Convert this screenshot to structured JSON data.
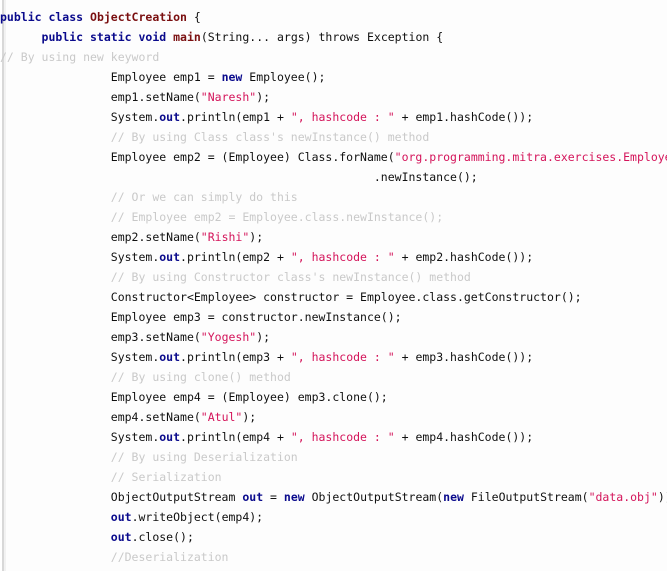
{
  "editor": {
    "language": "java",
    "background_color": "#fdfdfd",
    "colors": {
      "keyword": "#0a0a8c",
      "type_name": "#7a0f10",
      "string": "#d4145a",
      "comment": "#c9c9c9",
      "plain": "#101010"
    }
  },
  "code": {
    "lines": [
      {
        "indent": 0,
        "tokens": [
          {
            "t": "public class ",
            "c": "kw"
          },
          {
            "t": "ObjectCreation",
            "c": "type"
          },
          {
            "t": " {",
            "c": "plain"
          }
        ]
      },
      {
        "indent": 3,
        "tokens": [
          {
            "t": "public static void ",
            "c": "kw"
          },
          {
            "t": "main",
            "c": "type"
          },
          {
            "t": "(String... args) throws Exception {",
            "c": "plain"
          }
        ]
      },
      {
        "indent": -5,
        "tokens": [
          {
            "t": "// By using new keyword",
            "c": "cmt"
          }
        ]
      },
      {
        "indent": 8,
        "tokens": [
          {
            "t": "Employee emp1 = ",
            "c": "plain"
          },
          {
            "t": "new",
            "c": "kw"
          },
          {
            "t": " Employee();",
            "c": "plain"
          }
        ]
      },
      {
        "indent": 8,
        "tokens": [
          {
            "t": "emp1.setName(",
            "c": "plain"
          },
          {
            "t": "\"Naresh\"",
            "c": "str"
          },
          {
            "t": ");",
            "c": "plain"
          }
        ]
      },
      {
        "indent": 8,
        "tokens": [
          {
            "t": "System.",
            "c": "plain"
          },
          {
            "t": "out",
            "c": "kw"
          },
          {
            "t": ".println(emp1 + ",
            "c": "plain"
          },
          {
            "t": "\", hashcode : \"",
            "c": "str"
          },
          {
            "t": " + emp1.hashCode());",
            "c": "plain"
          }
        ]
      },
      {
        "indent": 8,
        "tokens": [
          {
            "t": "// By using Class class's newInstance() method",
            "c": "cmt"
          }
        ]
      },
      {
        "indent": 8,
        "tokens": [
          {
            "t": "Employee emp2 = (Employee) Class.forName(",
            "c": "plain"
          },
          {
            "t": "\"org.programming.mitra.exercises.Employee\"",
            "c": "str"
          },
          {
            "t": ")",
            "c": "plain"
          }
        ]
      },
      {
        "indent": 27,
        "tokens": [
          {
            "t": ".newInstance();",
            "c": "plain"
          }
        ]
      },
      {
        "indent": 8,
        "tokens": [
          {
            "t": "// Or we can simply do this",
            "c": "cmt"
          }
        ]
      },
      {
        "indent": 8,
        "tokens": [
          {
            "t": "// Employee emp2 = Employee.class.newInstance();",
            "c": "cmt"
          }
        ]
      },
      {
        "indent": 8,
        "tokens": [
          {
            "t": "emp2.setName(",
            "c": "plain"
          },
          {
            "t": "\"Rishi\"",
            "c": "str"
          },
          {
            "t": ");",
            "c": "plain"
          }
        ]
      },
      {
        "indent": 8,
        "tokens": [
          {
            "t": "System.",
            "c": "plain"
          },
          {
            "t": "out",
            "c": "kw"
          },
          {
            "t": ".println(emp2 + ",
            "c": "plain"
          },
          {
            "t": "\", hashcode : \"",
            "c": "str"
          },
          {
            "t": " + emp2.hashCode());",
            "c": "plain"
          }
        ]
      },
      {
        "indent": 8,
        "tokens": [
          {
            "t": "// By using Constructor class's newInstance() method",
            "c": "cmt"
          }
        ]
      },
      {
        "indent": 8,
        "tokens": [
          {
            "t": "Constructor<Employee> constructor = Employee.class.getConstructor();",
            "c": "plain"
          }
        ]
      },
      {
        "indent": 8,
        "tokens": [
          {
            "t": "Employee emp3 = constructor.newInstance();",
            "c": "plain"
          }
        ]
      },
      {
        "indent": 8,
        "tokens": [
          {
            "t": "emp3.setName(",
            "c": "plain"
          },
          {
            "t": "\"Yogesh\"",
            "c": "str"
          },
          {
            "t": ");",
            "c": "plain"
          }
        ]
      },
      {
        "indent": 8,
        "tokens": [
          {
            "t": "System.",
            "c": "plain"
          },
          {
            "t": "out",
            "c": "kw"
          },
          {
            "t": ".println(emp3 + ",
            "c": "plain"
          },
          {
            "t": "\", hashcode : \"",
            "c": "str"
          },
          {
            "t": " + emp3.hashCode());",
            "c": "plain"
          }
        ]
      },
      {
        "indent": 8,
        "tokens": [
          {
            "t": "// By using clone() method",
            "c": "cmt"
          }
        ]
      },
      {
        "indent": 8,
        "tokens": [
          {
            "t": "Employee emp4 = (Employee) emp3.clone();",
            "c": "plain"
          }
        ]
      },
      {
        "indent": 8,
        "tokens": [
          {
            "t": "emp4.setName(",
            "c": "plain"
          },
          {
            "t": "\"Atul\"",
            "c": "str"
          },
          {
            "t": ");",
            "c": "plain"
          }
        ]
      },
      {
        "indent": 8,
        "tokens": [
          {
            "t": "System.",
            "c": "plain"
          },
          {
            "t": "out",
            "c": "kw"
          },
          {
            "t": ".println(emp4 + ",
            "c": "plain"
          },
          {
            "t": "\", hashcode : \"",
            "c": "str"
          },
          {
            "t": " + emp4.hashCode());",
            "c": "plain"
          }
        ]
      },
      {
        "indent": 8,
        "tokens": [
          {
            "t": "// By using Deserialization",
            "c": "cmt"
          }
        ]
      },
      {
        "indent": 8,
        "tokens": [
          {
            "t": "// Serialization",
            "c": "cmt"
          }
        ]
      },
      {
        "indent": 8,
        "tokens": [
          {
            "t": "ObjectOutputStream ",
            "c": "plain"
          },
          {
            "t": "out",
            "c": "kw"
          },
          {
            "t": " = ",
            "c": "plain"
          },
          {
            "t": "new",
            "c": "kw"
          },
          {
            "t": " ObjectOutputStream(",
            "c": "plain"
          },
          {
            "t": "new",
            "c": "kw"
          },
          {
            "t": " FileOutputStream(",
            "c": "plain"
          },
          {
            "t": "\"data.obj\"",
            "c": "str"
          },
          {
            "t": "));",
            "c": "plain"
          }
        ]
      },
      {
        "indent": 8,
        "tokens": [
          {
            "t": "out",
            "c": "kw"
          },
          {
            "t": ".writeObject(emp4);",
            "c": "plain"
          }
        ]
      },
      {
        "indent": 8,
        "tokens": [
          {
            "t": "out",
            "c": "kw"
          },
          {
            "t": ".close();",
            "c": "plain"
          }
        ]
      },
      {
        "indent": 8,
        "tokens": [
          {
            "t": "//Deserialization",
            "c": "cmt"
          }
        ]
      }
    ]
  }
}
